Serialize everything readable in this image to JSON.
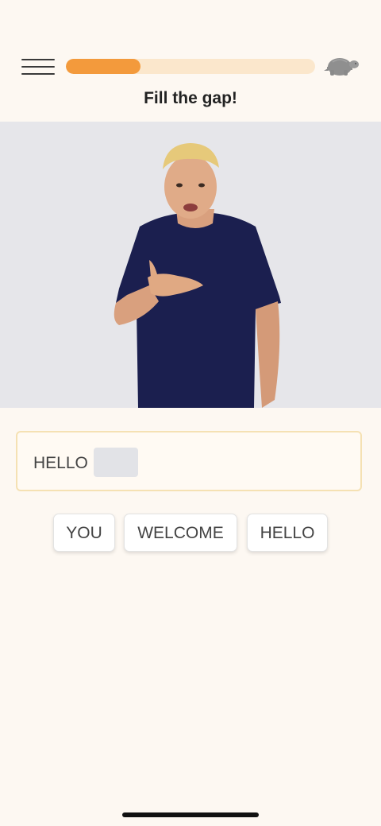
{
  "header": {
    "progress": 0.3,
    "progress_color": "#f39a3c",
    "track_color": "#fbe7cc",
    "slow_icon": "turtle-icon",
    "menu_icon": "hamburger-menu-icon"
  },
  "title": "Fill the gap!",
  "answer": {
    "words": [
      "HELLO"
    ]
  },
  "choices": [
    "YOU",
    "WELCOME",
    "HELLO"
  ]
}
